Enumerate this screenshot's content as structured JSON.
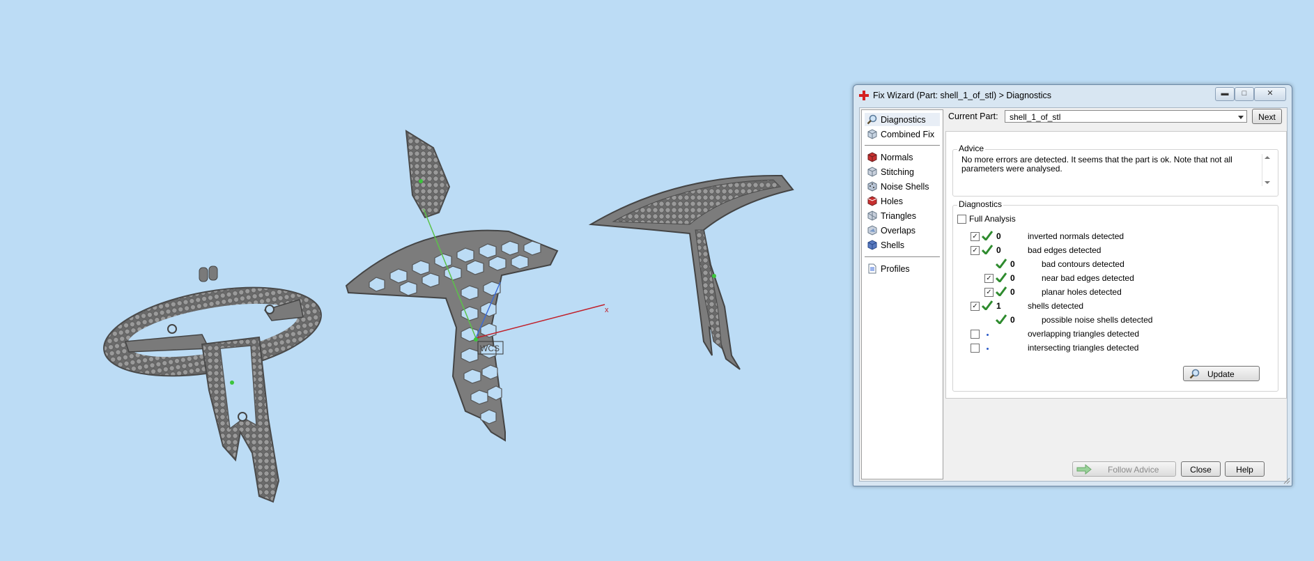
{
  "viewport": {
    "axis_x_label": "x",
    "axis_origin_label": "WCS"
  },
  "dialog": {
    "title": "Fix Wizard (Part: shell_1_of_stl) > Diagnostics",
    "window_buttons": [
      "minimize",
      "maximize",
      "close"
    ],
    "nav": {
      "items_top": [
        {
          "label": "Diagnostics",
          "icon": "magnifier-icon",
          "selected": true
        },
        {
          "label": "Combined Fix",
          "icon": "cube-icon"
        }
      ],
      "items_mid": [
        {
          "label": "Normals",
          "icon": "normals-icon"
        },
        {
          "label": "Stitching",
          "icon": "stitching-icon"
        },
        {
          "label": "Noise Shells",
          "icon": "noise-shells-icon"
        },
        {
          "label": "Holes",
          "icon": "holes-icon"
        },
        {
          "label": "Triangles",
          "icon": "triangles-icon"
        },
        {
          "label": "Overlaps",
          "icon": "overlaps-icon"
        },
        {
          "label": "Shells",
          "icon": "shells-icon"
        }
      ],
      "items_bottom": [
        {
          "label": "Profiles",
          "icon": "document-icon"
        }
      ]
    },
    "current_part_label": "Current Part:",
    "current_part_value": "shell_1_of_stl",
    "next_label": "Next",
    "advice": {
      "title": "Advice",
      "text": "No more errors are detected. It seems that the part is ok. Note that not all parameters were analysed."
    },
    "diagnostics": {
      "title": "Diagnostics",
      "full_analysis_label": "Full Analysis",
      "full_analysis_checked": false,
      "rows": [
        {
          "checked": true,
          "status": "ok",
          "count": "0",
          "label": "inverted normals detected",
          "indent": false
        },
        {
          "checked": true,
          "status": "ok",
          "count": "0",
          "label": "bad edges detected",
          "indent": false
        },
        {
          "checkbox": false,
          "status": "ok",
          "count": "0",
          "label": "bad contours detected",
          "indent": true
        },
        {
          "checked": true,
          "status": "ok",
          "count": "0",
          "label": "near bad edges detected",
          "indent": true
        },
        {
          "checked": true,
          "status": "ok",
          "count": "0",
          "label": "planar holes detected",
          "indent": true
        },
        {
          "checked": true,
          "status": "ok",
          "count": "1",
          "label": "shells detected",
          "indent": false
        },
        {
          "checkbox": false,
          "status": "ok",
          "count": "0",
          "label": "possible noise shells detected",
          "indent": true
        },
        {
          "checked": false,
          "status": "not-run",
          "count": "",
          "label": "overlapping triangles detected",
          "indent": false
        },
        {
          "checked": false,
          "status": "not-run",
          "count": "",
          "label": "intersecting triangles detected",
          "indent": false
        }
      ],
      "update_label": "Update"
    },
    "footer": {
      "follow_advice_label": "Follow Advice",
      "close_label": "Close",
      "help_label": "Help"
    }
  },
  "colors": {
    "background": "#bcdcf5",
    "model": "#7a7a7a",
    "check_green": "#2e8b2e",
    "axis_red": "#c0202a",
    "axis_green": "#5bc24a",
    "axis_blue": "#3a6ad8"
  }
}
